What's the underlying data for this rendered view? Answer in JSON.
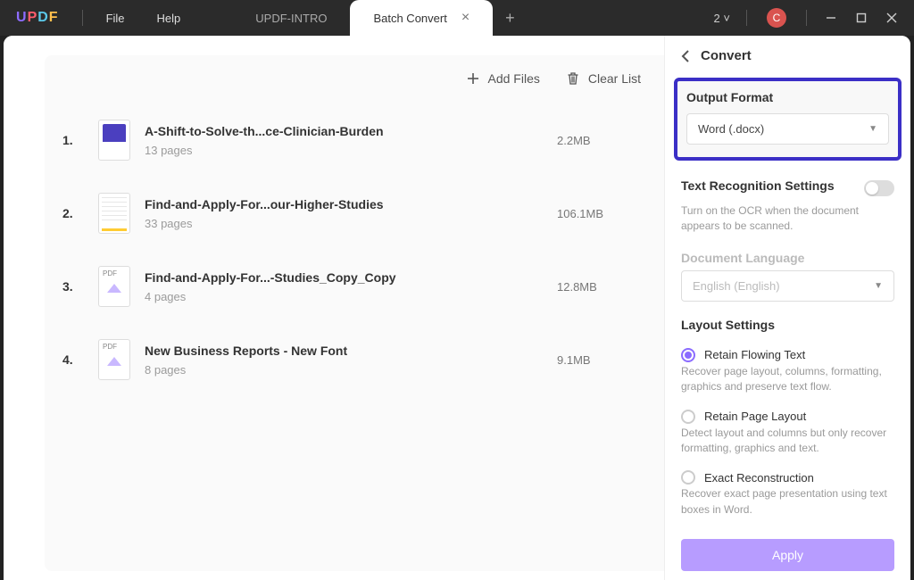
{
  "titlebar": {
    "logo_letters": [
      "U",
      "P",
      "D",
      "F"
    ],
    "menu_file": "File",
    "menu_help": "Help",
    "tabs": [
      {
        "label": "UPDF-INTRO",
        "active": false
      },
      {
        "label": "Batch Convert",
        "active": true
      }
    ],
    "open_count": "2",
    "avatar_initial": "C"
  },
  "toolbar": {
    "add_files": "Add Files",
    "clear_list": "Clear List"
  },
  "files": [
    {
      "idx": "1.",
      "name": "A-Shift-to-Solve-th...ce-Clinician-Burden",
      "pages": "13 pages",
      "size": "2.2MB",
      "thumb": "doc"
    },
    {
      "idx": "2.",
      "name": "Find-and-Apply-For...our-Higher-Studies",
      "pages": "33 pages",
      "size": "106.1MB",
      "thumb": "yellow"
    },
    {
      "idx": "3.",
      "name": "Find-and-Apply-For...-Studies_Copy_Copy",
      "pages": "4 pages",
      "size": "12.8MB",
      "thumb": "pdf"
    },
    {
      "idx": "4.",
      "name": "New Business Reports - New Font",
      "pages": "8 pages",
      "size": "9.1MB",
      "thumb": "pdf"
    }
  ],
  "panel": {
    "title": "Convert",
    "output_format_label": "Output Format",
    "output_format_value": "Word (.docx)",
    "ocr": {
      "title": "Text Recognition Settings",
      "desc": "Turn on the OCR when the document appears to be scanned.",
      "enabled": false,
      "lang_label": "Document Language",
      "lang_value": "English (English)"
    },
    "layout": {
      "title": "Layout Settings",
      "options": [
        {
          "label": "Retain Flowing Text",
          "desc": "Recover page layout, columns, formatting, graphics and preserve text flow.",
          "selected": true
        },
        {
          "label": "Retain Page Layout",
          "desc": "Detect layout and columns but only recover formatting, graphics and text.",
          "selected": false
        },
        {
          "label": "Exact Reconstruction",
          "desc": "Recover exact page presentation using text boxes in Word.",
          "selected": false
        }
      ]
    },
    "apply": "Apply"
  }
}
